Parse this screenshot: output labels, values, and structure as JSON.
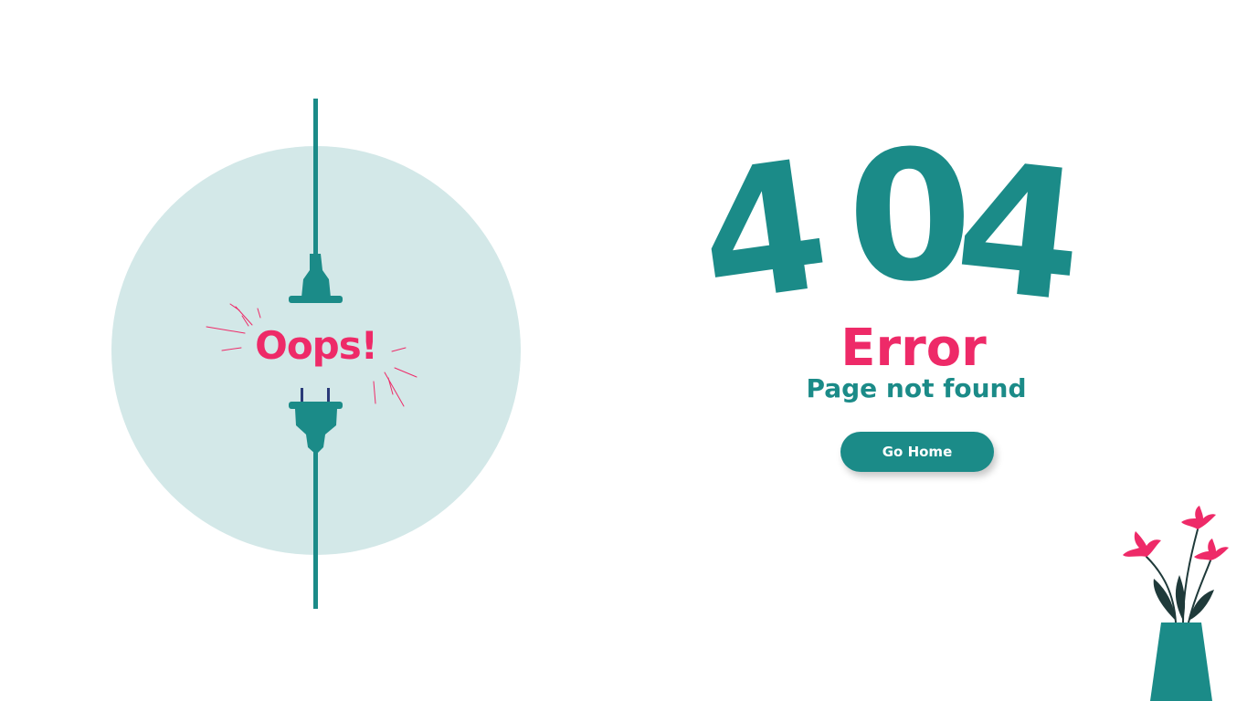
{
  "illustration": {
    "exclamation": "Oops!",
    "colors": {
      "circle": "#d3e8e8",
      "cable": "#1b8b88",
      "plug_prongs": "#2a3a78",
      "spark": "#ee2a68"
    }
  },
  "error": {
    "code_digits": [
      "4",
      "0",
      "4"
    ],
    "title": "Error",
    "subtitle": "Page not found",
    "button_label": "Go Home"
  },
  "theme": {
    "primary": "#1b8b88",
    "accent": "#ee2a68",
    "background": "#ffffff"
  },
  "decoration": {
    "icon": "flower-vase-icon",
    "colors": {
      "vase": "#1b8b88",
      "petals": "#ee2a68",
      "leaves": "#1f3a3a"
    }
  }
}
